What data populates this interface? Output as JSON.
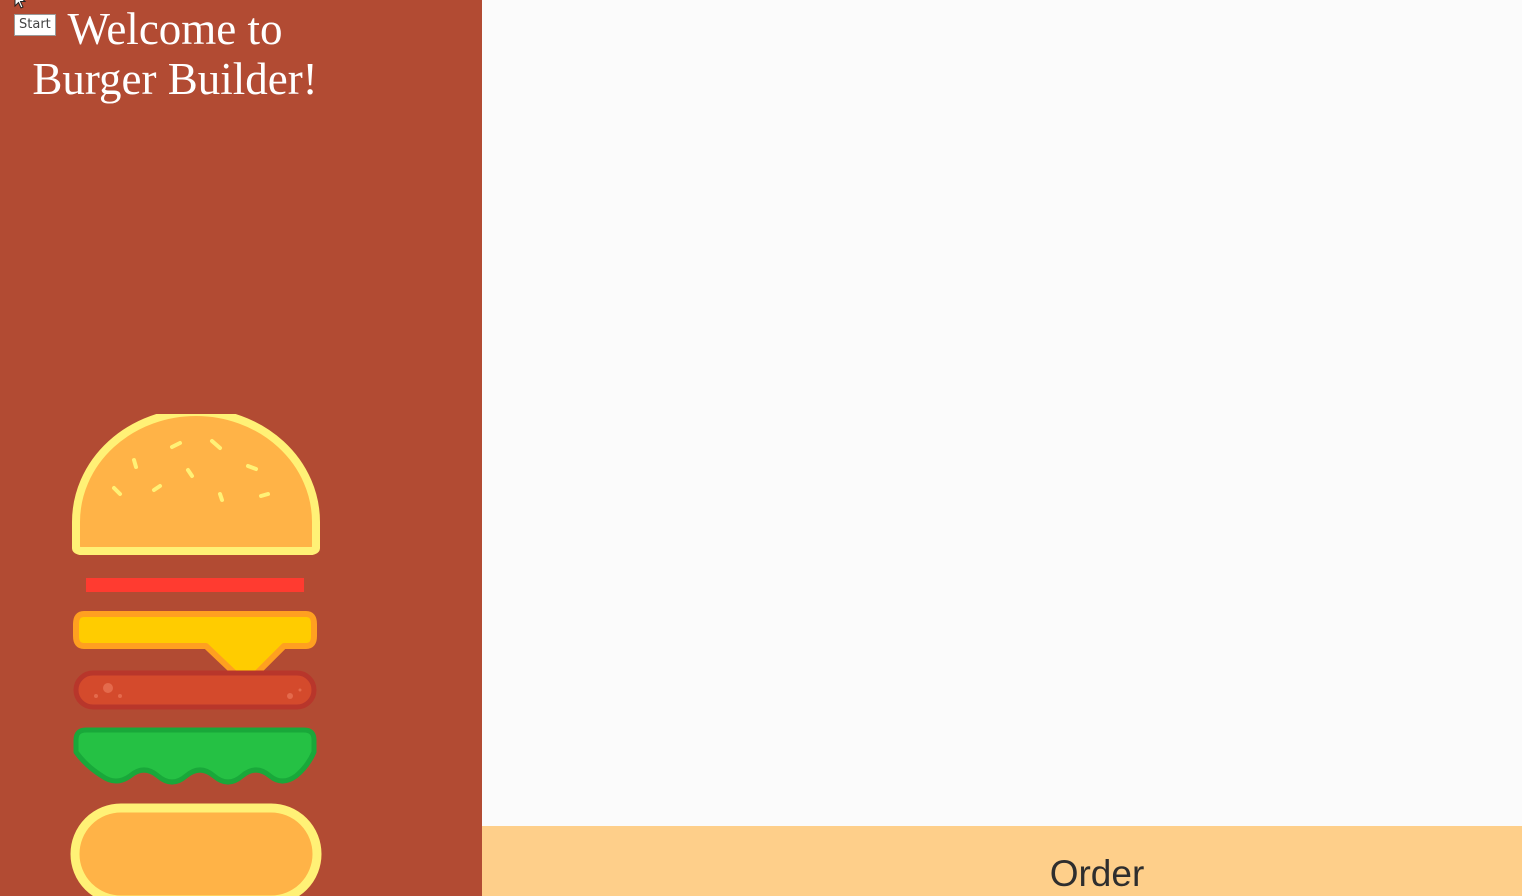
{
  "sidebar": {
    "title": "Welcome to Burger Builder!",
    "start_tooltip": "Start",
    "burger_layers": [
      "bun-top-icon",
      "tomato-icon",
      "cheese-icon",
      "patty-icon",
      "lettuce-icon",
      "bun-bottom-icon"
    ]
  },
  "order_bar": {
    "label": "Order"
  },
  "colors": {
    "sidebar_bg": "#b24b33",
    "main_bg": "#fbfbfb",
    "order_bar_bg": "#fecf8a",
    "bun": "#ffb347",
    "bun_outline": "#fff176",
    "tomato": "#ff3b30",
    "cheese": "#ffcc00",
    "patty": "#d44a2c",
    "lettuce": "#25c144"
  }
}
